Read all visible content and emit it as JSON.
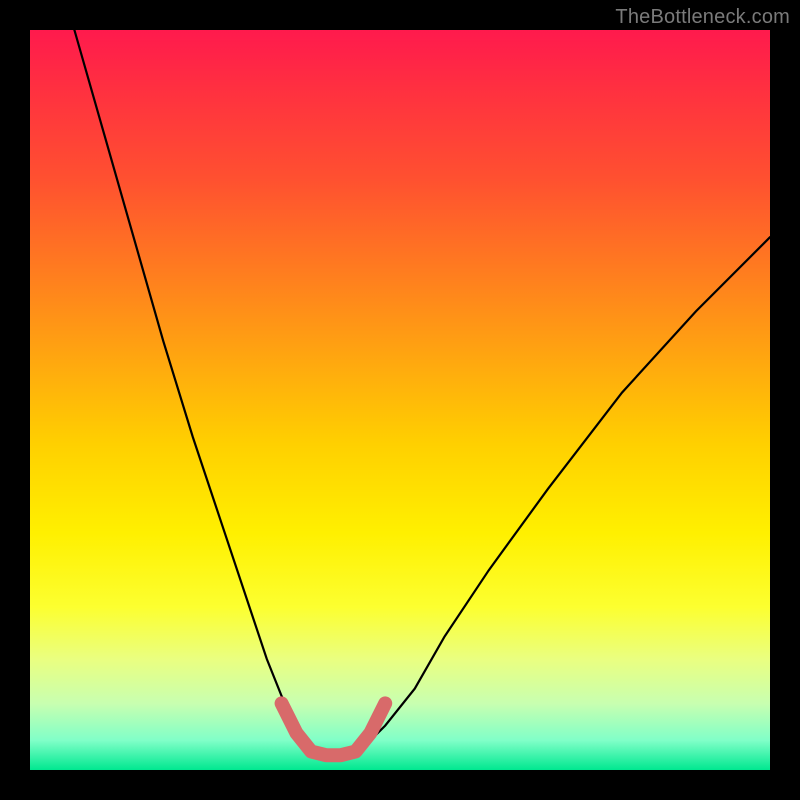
{
  "watermark": "TheBottleneck.com",
  "colors": {
    "frame": "#000000",
    "curve_black": "#000000",
    "highlight": "#d86a6a",
    "gradient_top": "#ff1a4d",
    "gradient_bottom": "#00e890"
  },
  "chart_data": {
    "type": "line",
    "title": "",
    "xlabel": "",
    "ylabel": "",
    "xlim": [
      0,
      100
    ],
    "ylim": [
      0,
      100
    ],
    "grid": false,
    "legend": false,
    "annotations": [
      "TheBottleneck.com"
    ],
    "series": [
      {
        "name": "left_branch",
        "color": "#000000",
        "x": [
          6,
          10,
          14,
          18,
          22,
          26,
          30,
          32,
          34,
          36,
          37
        ],
        "values": [
          100,
          86,
          72,
          58,
          45,
          33,
          21,
          15,
          10,
          6,
          4
        ]
      },
      {
        "name": "right_branch",
        "color": "#000000",
        "x": [
          46,
          48,
          52,
          56,
          62,
          70,
          80,
          90,
          100
        ],
        "values": [
          4,
          6,
          11,
          18,
          27,
          38,
          51,
          62,
          72
        ]
      },
      {
        "name": "floor_highlight",
        "color": "#d86a6a",
        "x": [
          34,
          36,
          38,
          40,
          42,
          44,
          46,
          48
        ],
        "values": [
          9,
          5,
          2.5,
          2,
          2,
          2.5,
          5,
          9
        ]
      }
    ]
  }
}
